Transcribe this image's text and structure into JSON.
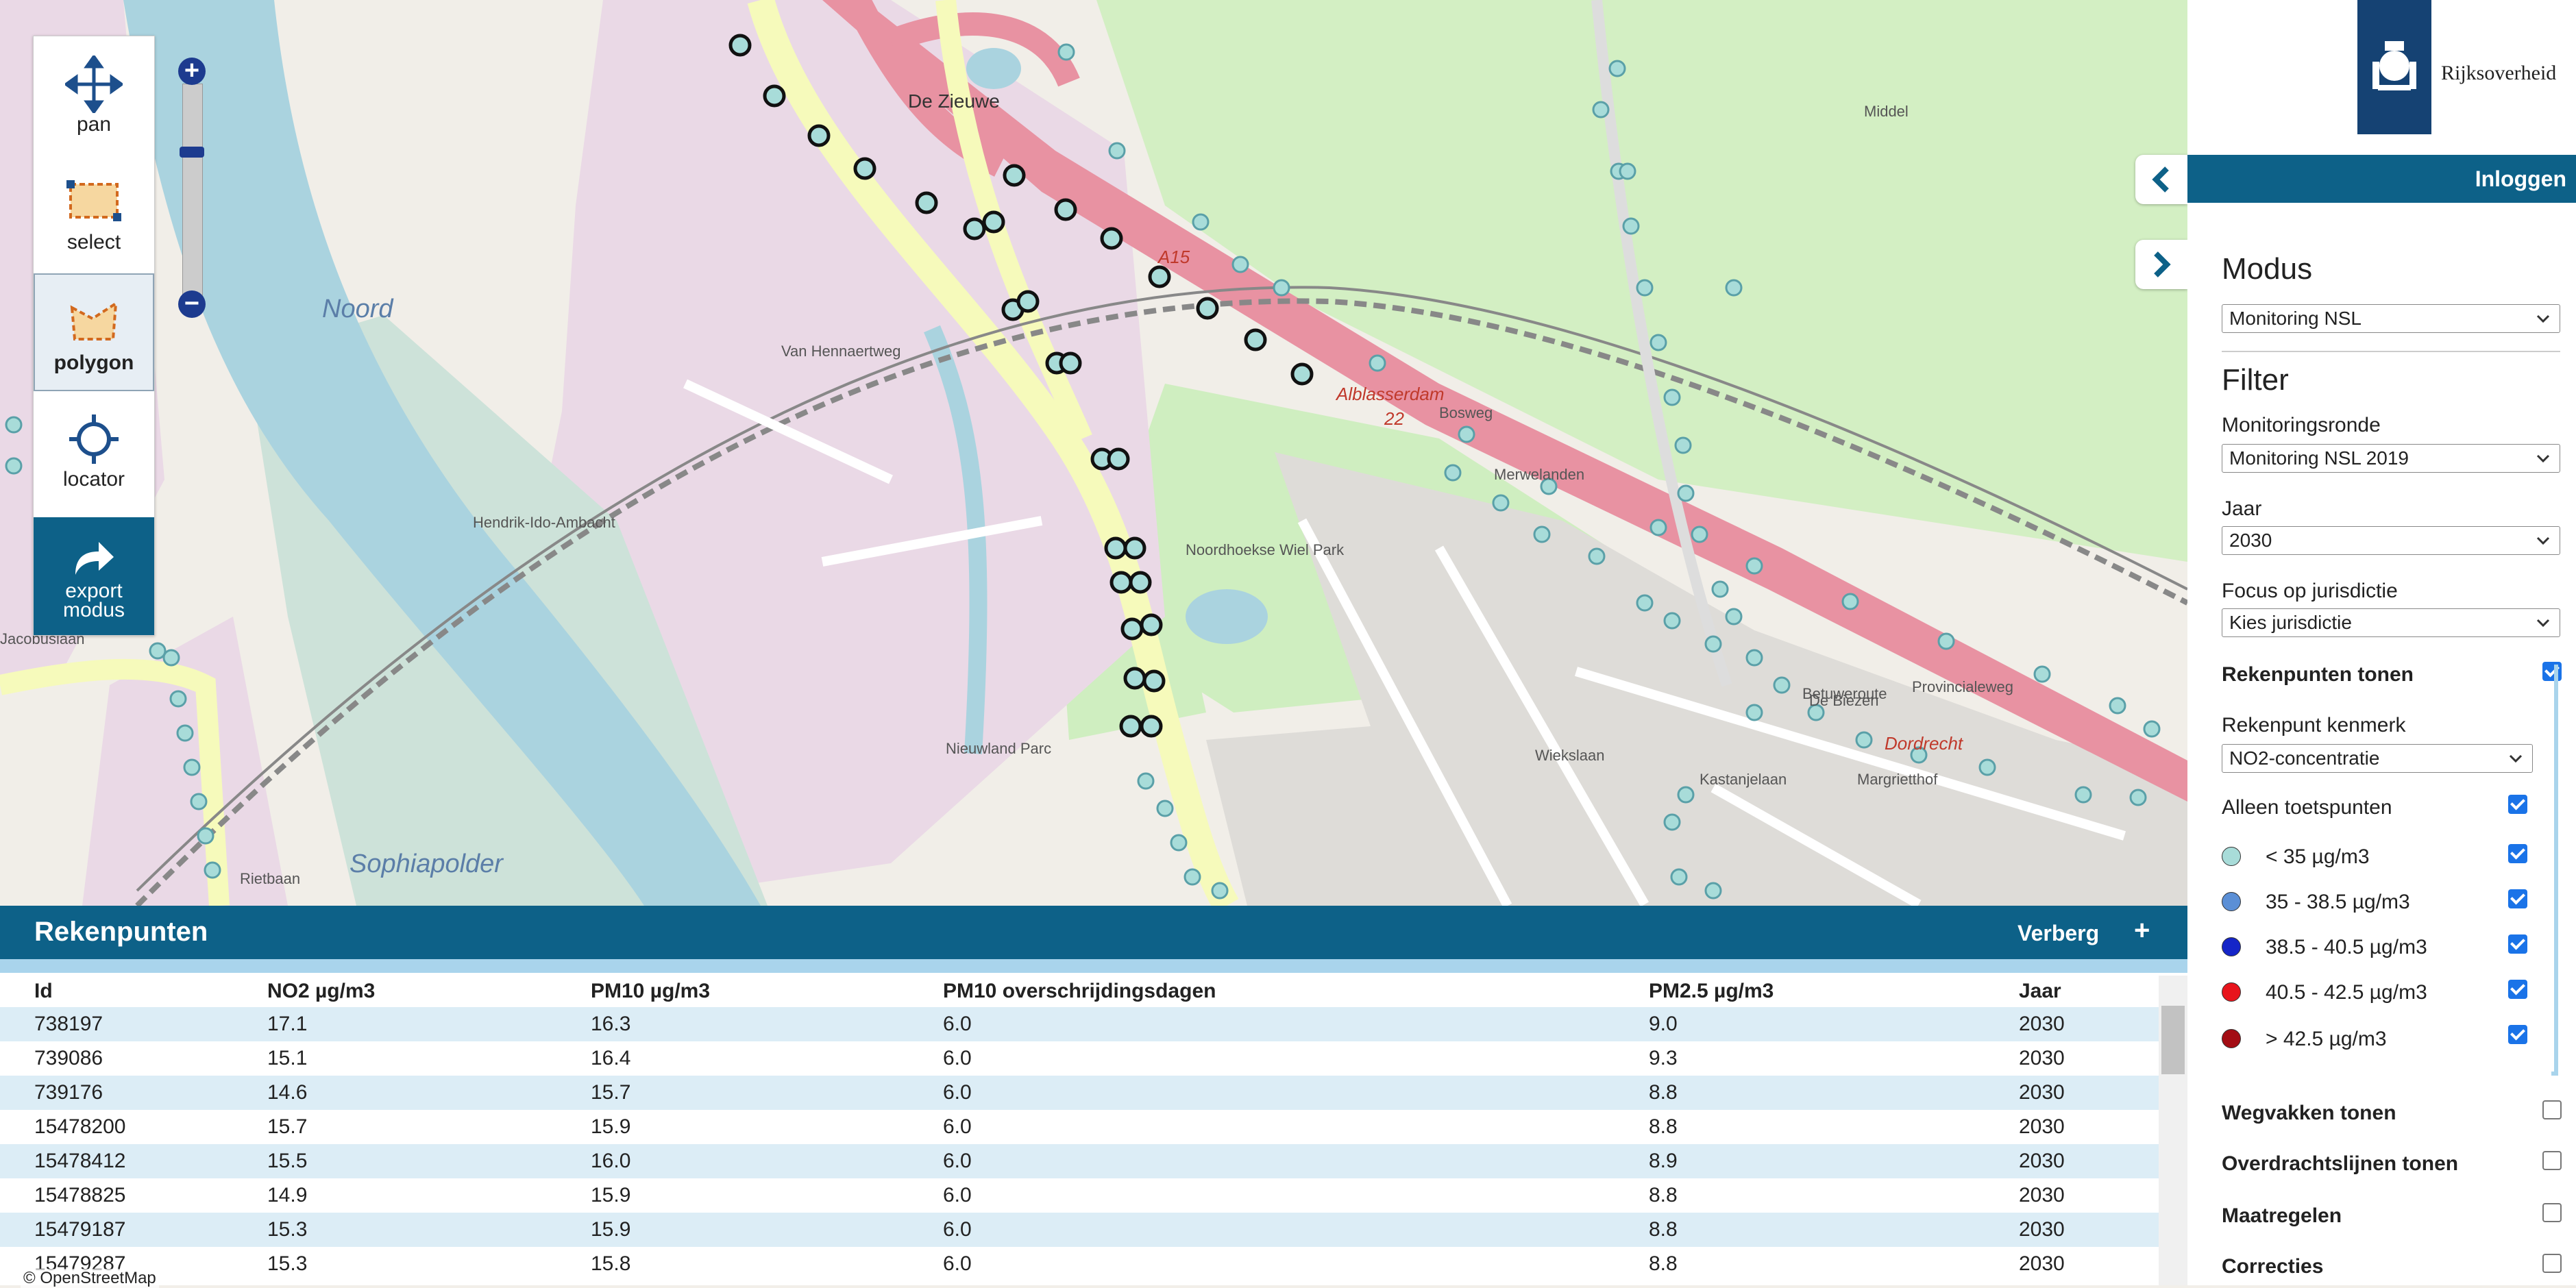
{
  "map": {
    "labels": [
      {
        "text": "De Zieuwe",
        "cls": "place"
      },
      {
        "text": "A15",
        "cls": "road-ref"
      },
      {
        "text": "Alblasserdam",
        "cls": "road-ref"
      },
      {
        "text": "22",
        "cls": "road-ref"
      },
      {
        "text": "Bosweg",
        "cls": "street"
      },
      {
        "text": "Middel",
        "cls": "street"
      },
      {
        "text": "Noord",
        "cls": "water-label"
      },
      {
        "text": "Sophiapolder",
        "cls": "water-label"
      },
      {
        "text": "Noordhoekse Wiel Park",
        "cls": "street"
      },
      {
        "text": "Van Hennaertweg",
        "cls": "street"
      },
      {
        "text": "Nieuwland Parc",
        "cls": "street"
      },
      {
        "text": "Hendrik-Ido-Ambacht",
        "cls": "street"
      },
      {
        "text": "Rietbaan",
        "cls": "street"
      },
      {
        "text": "Jacobuslaan",
        "cls": "street"
      },
      {
        "text": "Betuweroute",
        "cls": "street"
      },
      {
        "text": "Provincialeweg",
        "cls": "street"
      },
      {
        "text": "Dordrecht",
        "cls": "road-ref"
      },
      {
        "text": "Margrietthof",
        "cls": "street"
      },
      {
        "text": "Kastanjelaan",
        "cls": "street"
      },
      {
        "text": "Wiekslaan",
        "cls": "street"
      },
      {
        "text": "De Biezen",
        "cls": "street"
      },
      {
        "text": "Merwelanden",
        "cls": "street"
      }
    ],
    "attribution": "© OpenStreetMap"
  },
  "toolbar": {
    "tools": [
      {
        "label": "pan",
        "icon": "move-icon"
      },
      {
        "label": "select",
        "icon": "select-box-icon"
      },
      {
        "label": "polygon",
        "icon": "polygon-icon"
      },
      {
        "label": "locator",
        "icon": "crosshair-icon"
      },
      {
        "label": "export modus",
        "icon": "share-arrow-icon"
      }
    ],
    "active": "polygon",
    "zoom_in": "+",
    "zoom_out": "−"
  },
  "panel": {
    "logo_text": "Rijksoverheid",
    "login": "Inloggen",
    "modus_heading": "Modus",
    "modus_value": "Monitoring NSL",
    "filter_heading": "Filter",
    "ronde_label": "Monitoringsronde",
    "ronde_value": "Monitoring NSL 2019",
    "jaar_label": "Jaar",
    "jaar_value": "2030",
    "focus_label": "Focus op jurisdictie",
    "focus_value": "Kies jurisdictie",
    "rekenpunten_tonen": "Rekenpunten tonen",
    "kenmerk_label": "Rekenpunt kenmerk",
    "kenmerk_value": "NO2-concentratie",
    "toetspunten": "Alleen toetspunten",
    "legend": [
      {
        "label": "< 35 µg/m3",
        "color": "#a8dcd9"
      },
      {
        "label": "35 - 38.5 µg/m3",
        "color": "#5b8fd6"
      },
      {
        "label": "38.5 - 40.5 µg/m3",
        "color": "#1525c8"
      },
      {
        "label": "40.5 - 42.5 µg/m3",
        "color": "#e8141c"
      },
      {
        "label": "> 42.5 µg/m3",
        "color": "#a30d14"
      }
    ],
    "layers": [
      {
        "label": "Wegvakken tonen",
        "checked": false
      },
      {
        "label": "Overdrachtslijnen tonen",
        "checked": false
      },
      {
        "label": "Maatregelen",
        "checked": false
      },
      {
        "label": "Correcties",
        "checked": false
      }
    ],
    "colors": {
      "accent": "#0d6188",
      "check": "#1a73e8",
      "legend_bracket": "#a9d4ec"
    }
  },
  "table": {
    "title": "Rekenpunten",
    "hide": "Verberg",
    "expand": "+",
    "columns": [
      "Id",
      "NO2 µg/m3",
      "PM10 µg/m3",
      "PM10 overschrijdingsdagen",
      "PM2.5 µg/m3",
      "Jaar"
    ],
    "rows": [
      [
        "738197",
        "17.1",
        "16.3",
        "6.0",
        "9.0",
        "2030"
      ],
      [
        "739086",
        "15.1",
        "16.4",
        "6.0",
        "9.3",
        "2030"
      ],
      [
        "739176",
        "14.6",
        "15.7",
        "6.0",
        "8.8",
        "2030"
      ],
      [
        "15478200",
        "15.7",
        "15.9",
        "6.0",
        "8.8",
        "2030"
      ],
      [
        "15478412",
        "15.5",
        "16.0",
        "6.0",
        "8.9",
        "2030"
      ],
      [
        "15478825",
        "14.9",
        "15.9",
        "6.0",
        "8.8",
        "2030"
      ],
      [
        "15479187",
        "15.3",
        "15.9",
        "6.0",
        "8.8",
        "2030"
      ],
      [
        "15479287",
        "15.3",
        "15.8",
        "6.0",
        "8.8",
        "2030"
      ]
    ]
  }
}
